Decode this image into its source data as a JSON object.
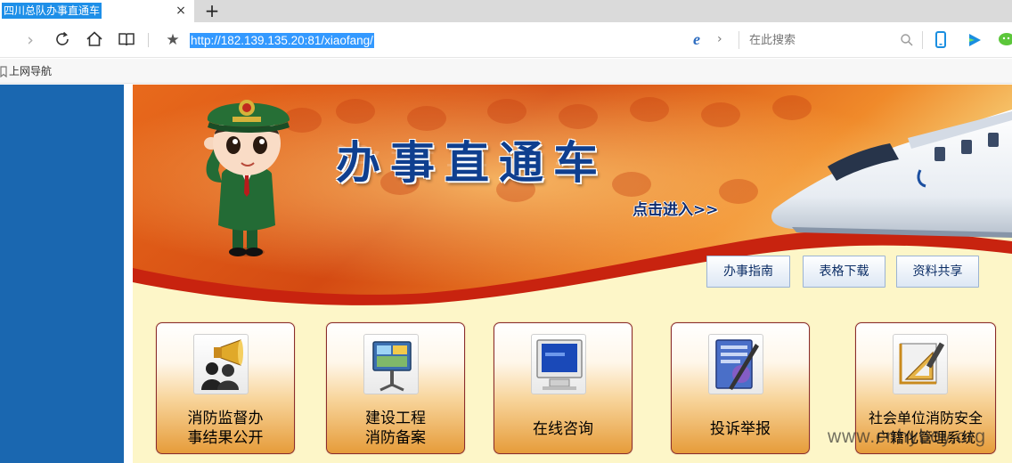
{
  "browser": {
    "tab_title": "四川总队办事直通车",
    "tab_close": "×",
    "new_tab": "+",
    "url": "http://182.139.135.20:81/xiaofang/",
    "search_placeholder": "在此搜索",
    "favorites": [
      {
        "label": "上网导航",
        "icon": "bookmark-icon"
      }
    ],
    "extension_icons": [
      "phone-icon",
      "play-icon",
      "chat-icon"
    ]
  },
  "banner": {
    "title": "办事直通车",
    "enter_link": "点击进入>>"
  },
  "top_buttons": [
    {
      "label": "办事指南"
    },
    {
      "label": "表格下载"
    },
    {
      "label": "资料共享"
    }
  ],
  "service_cards": [
    {
      "line1": "消防监督办",
      "line2": "事结果公开",
      "icon": "megaphone-people-icon"
    },
    {
      "line1": "建设工程",
      "line2": "消防备案",
      "icon": "presentation-board-icon"
    },
    {
      "line1": "在线咨询",
      "line2": "",
      "icon": "monitor-icon"
    },
    {
      "line1": "投诉举报",
      "line2": "",
      "icon": "document-pen-icon"
    },
    {
      "line1": "社会单位消防安全",
      "line2": "户籍化管理系统",
      "icon": "ruler-triangle-icon"
    }
  ],
  "watermark": "www.cnhyboy.org",
  "colors": {
    "left_panel": "#1a67b0",
    "page_background": "#fdf6c8",
    "banner_orange": "#e8641a",
    "banner_title": "#0f3f8f",
    "url_highlight": "#3399ff",
    "tab_highlight": "#1e8fe8"
  }
}
